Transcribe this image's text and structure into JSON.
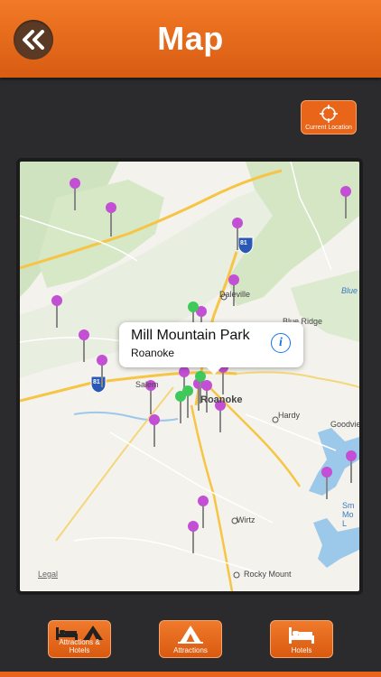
{
  "header": {
    "title": "Map",
    "back_icon": "double-chevron-left-icon"
  },
  "current_location": {
    "label": "Current Location",
    "icon": "crosshair-icon"
  },
  "map": {
    "legal": "Legal",
    "labels": {
      "daleville": "Daleville",
      "blue_ridge": "Blue Ridge",
      "blue": "Blue",
      "salem": "Salem",
      "roanoke": "Roanoke",
      "hardy": "Hardy",
      "goodview": "Goodvie",
      "wirtz": "Wirtz",
      "rocky_mount": "Rocky Mount",
      "smith_mountain": "Sm Mo L",
      "i81_north": "81",
      "i81_south": "81"
    },
    "popup": {
      "title": "Mill Mountain Park",
      "subtitle": "Roanoke",
      "info_icon": "info-icon"
    }
  },
  "tabs": {
    "attractions_hotels": "Attractions & Hotels",
    "attractions": "Attractions",
    "hotels": "Hotels"
  },
  "colors": {
    "accent": "#e8651a",
    "pin_purple": "#c24fd4",
    "pin_green": "#3ec95a",
    "background": "#2b2b2d"
  }
}
